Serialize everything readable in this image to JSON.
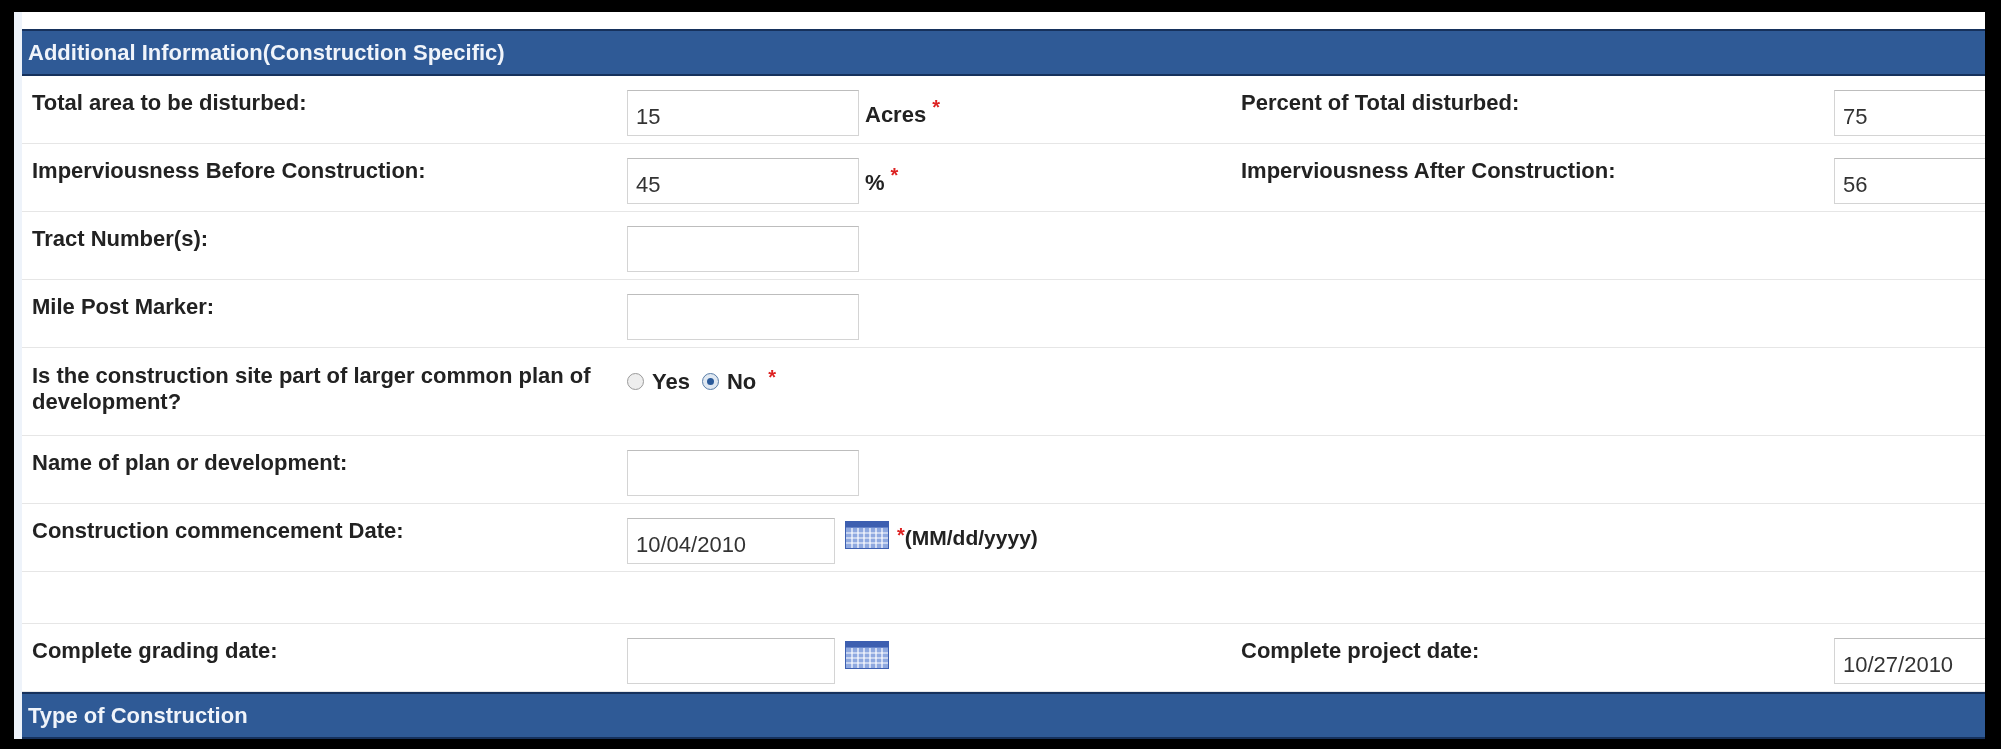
{
  "section_header": "Additional Information(Construction Specific)",
  "rows": [
    {
      "kind": "field",
      "label": "Total area to be disturbed:",
      "value": "15",
      "unit": "Acres",
      "marker": "*",
      "right_label": "Percent of Total disturbed:",
      "right_value": "75"
    },
    {
      "kind": "field",
      "label": "Imperviousness Before Construction:",
      "value": "45",
      "unit": "%",
      "marker": "*",
      "right_label": "Imperviousness After Construction:",
      "right_value": "56"
    },
    {
      "kind": "field",
      "label": "Tract Number(s):"
    },
    {
      "kind": "field",
      "label": "Mile Post Marker:"
    },
    {
      "kind": "radio",
      "label": "Is the construction site part of larger common plan of development?",
      "marker": "*",
      "options": [
        {
          "label": "Yes",
          "selected": false
        },
        {
          "label": "No",
          "selected": true
        }
      ]
    },
    {
      "kind": "field",
      "label": "Name of plan or development:"
    },
    {
      "kind": "date",
      "label": "Construction commencement Date:",
      "value": "10/04/2010",
      "marker": "*",
      "hint": "(MM/dd/yyyy)"
    },
    {
      "kind": "blank"
    },
    {
      "kind": "date",
      "label": "Complete grading date:",
      "right_label": "Complete project date:",
      "right_value": "10/27/2010"
    }
  ],
  "next_section_header": "Type of Construction"
}
